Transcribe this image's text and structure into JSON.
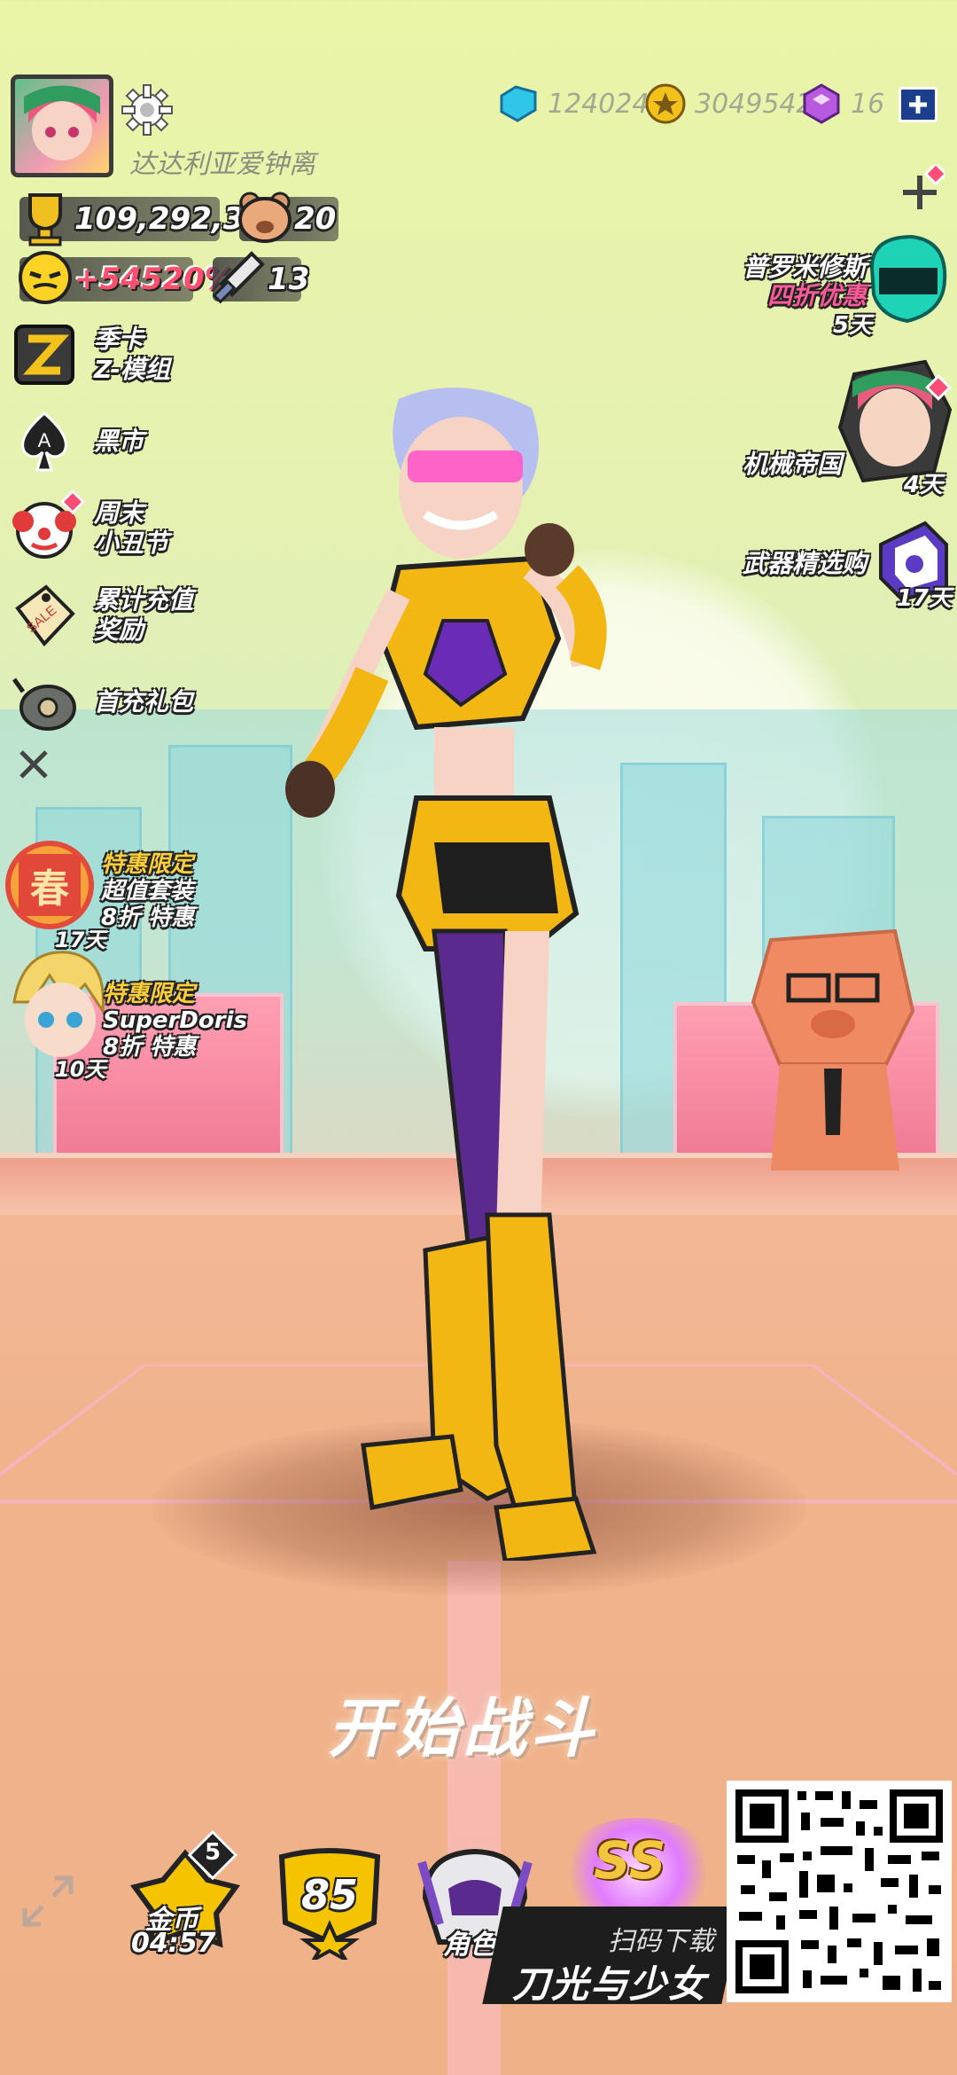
{
  "profile": {
    "username": "达达利亚爱钟离",
    "trophies": "109,292,327",
    "bears": "20",
    "rank_bonus": "+54520%",
    "swords": "13"
  },
  "currencies": [
    {
      "icon": "blue-crystal-icon",
      "value": "124024"
    },
    {
      "icon": "gold-coin-icon",
      "value": "3049542"
    },
    {
      "icon": "purple-cube-icon",
      "value": "16"
    }
  ],
  "left_menu": [
    {
      "id": "season-card",
      "icon": "z-module-icon",
      "lines": [
        "季卡",
        "Z-模组"
      ]
    },
    {
      "id": "black-market",
      "icon": "spade-icon",
      "lines": [
        "黑市"
      ]
    },
    {
      "id": "weekend-clown",
      "icon": "clown-icon",
      "lines": [
        "周末",
        "小丑节"
      ]
    },
    {
      "id": "recharge-reward",
      "icon": "sale-tag-icon",
      "lines": [
        "累计充值",
        "奖励"
      ]
    },
    {
      "id": "first-recharge",
      "icon": "gift-pack-icon",
      "lines": [
        "首充礼包"
      ]
    }
  ],
  "left_offers": [
    {
      "icon": "spring-badge-icon",
      "badge": "春",
      "lines": [
        "特惠限定",
        "超值套装",
        "8折 特惠"
      ],
      "days": "17天"
    },
    {
      "icon": "superdoris-avatar-icon",
      "lines": [
        "特惠限定",
        "SuperDoris",
        "8折 特惠"
      ],
      "days": "10天"
    }
  ],
  "right_offers": [
    {
      "id": "prometheus",
      "lines": [
        "普罗米修斯",
        "四折优惠"
      ],
      "days": "5天"
    },
    {
      "id": "machine-empire",
      "lines": [
        "机械帝国"
      ],
      "days": "4天"
    },
    {
      "id": "weapon-select",
      "lines": [
        "武器精选购"
      ],
      "days": "17天"
    }
  ],
  "start_label": "开始战斗",
  "bottom": {
    "coin_badge": "5",
    "coin_label": "金币",
    "coin_timer": "04:57",
    "level_value": "85",
    "role_label": "角色",
    "ss_label": "SS",
    "qr_scan_label": "扫码下载",
    "qr_game_title": "刀光与少女"
  },
  "colors": {
    "accent_red": "#ff3b3b",
    "gold": "#f5c400",
    "purple": "#7a33c9",
    "blue": "#1b6fd1"
  }
}
